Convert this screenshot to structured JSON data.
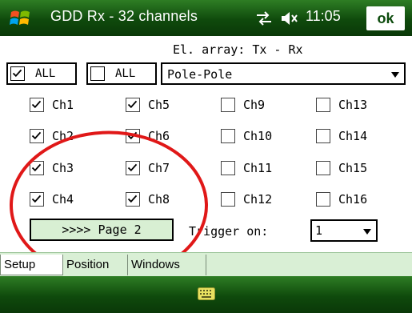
{
  "titlebar": {
    "title": "GDD Rx - 32 channels",
    "time": "11:05",
    "ok_label": "ok",
    "icons": [
      "windows-start-icon",
      "signal-icon",
      "volume-icon"
    ]
  },
  "header": {
    "el_array": "El. array: Tx - Rx"
  },
  "controls": {
    "all_checked": {
      "label": "ALL",
      "checked": true
    },
    "all_unchecked": {
      "label": "ALL",
      "checked": false
    },
    "array_select": {
      "value": "Pole-Pole"
    }
  },
  "channels": [
    {
      "label": "Ch1",
      "checked": true
    },
    {
      "label": "Ch2",
      "checked": true
    },
    {
      "label": "Ch3",
      "checked": true
    },
    {
      "label": "Ch4",
      "checked": true
    },
    {
      "label": "Ch5",
      "checked": true
    },
    {
      "label": "Ch6",
      "checked": true
    },
    {
      "label": "Ch7",
      "checked": true
    },
    {
      "label": "Ch8",
      "checked": true
    },
    {
      "label": "Ch9",
      "checked": false
    },
    {
      "label": "Ch10",
      "checked": false
    },
    {
      "label": "Ch11",
      "checked": false
    },
    {
      "label": "Ch12",
      "checked": false
    },
    {
      "label": "Ch13",
      "checked": false
    },
    {
      "label": "Ch14",
      "checked": false
    },
    {
      "label": "Ch15",
      "checked": false
    },
    {
      "label": "Ch16",
      "checked": false
    }
  ],
  "footer": {
    "page_button": ">>>> Page 2",
    "trigger_label": "Trigger on:",
    "trigger_value": "1"
  },
  "tabs": [
    {
      "label": "Setup",
      "active": true
    },
    {
      "label": "Position",
      "active": false
    },
    {
      "label": "Windows",
      "active": false
    }
  ],
  "colors": {
    "bar_green": "#1a5c14",
    "tab_bg": "#d9efd5",
    "annotation_red": "#e01818"
  }
}
